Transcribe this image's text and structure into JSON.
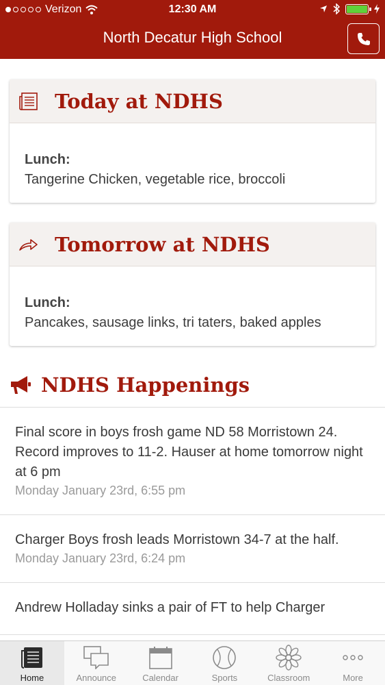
{
  "status_bar": {
    "carrier": "Verizon",
    "time": "12:30 AM"
  },
  "app_bar": {
    "title": "North Decatur High School",
    "phone_icon": "phone-icon"
  },
  "today": {
    "title": "Today at NDHS",
    "icon": "newspaper-icon",
    "lunch_label": "Lunch:",
    "lunch_text": "Tangerine Chicken, vegetable rice, broccoli"
  },
  "tomorrow": {
    "title": "Tomorrow at NDHS",
    "icon": "share-arrow-icon",
    "lunch_label": "Lunch:",
    "lunch_text": "Pancakes, sausage links, tri taters, baked apples"
  },
  "happenings": {
    "title": "NDHS Happenings",
    "icon": "megaphone-icon",
    "items": [
      {
        "text": "Final score in boys frosh game ND 58 Morristown 24. Record improves to 11-2. Hauser at home tomorrow night at 6 pm",
        "date": "Monday January 23rd, 6:55 pm"
      },
      {
        "text": "Charger Boys frosh leads Morristown 34-7 at the half.",
        "date": "Monday January 23rd, 6:24 pm"
      },
      {
        "text": "Andrew Holladay sinks a pair of FT to help Charger",
        "date": ""
      }
    ]
  },
  "tabs": [
    {
      "label": "Home",
      "icon": "home-newspaper-icon",
      "active": true
    },
    {
      "label": "Announce",
      "icon": "chat-bubbles-icon",
      "active": false
    },
    {
      "label": "Calendar",
      "icon": "calendar-icon",
      "active": false
    },
    {
      "label": "Sports",
      "icon": "baseball-icon",
      "active": false
    },
    {
      "label": "Classroom",
      "icon": "classroom-flower-icon",
      "active": false
    },
    {
      "label": "More",
      "icon": "more-dots-icon",
      "active": false
    }
  ],
  "colors": {
    "brand": "#a11a0c",
    "battery": "#5fd13a"
  }
}
